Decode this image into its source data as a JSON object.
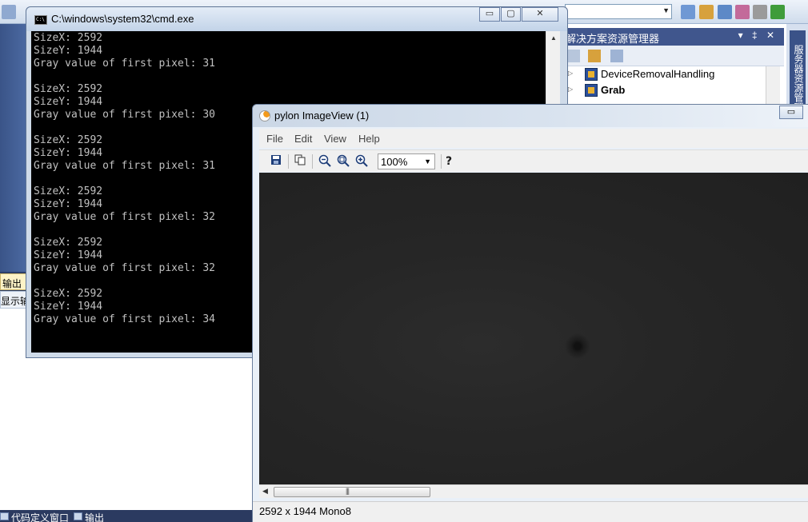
{
  "ide": {
    "combo_value": "",
    "solution_explorer": {
      "title": "解决方案资源管理器",
      "controls": "▾ ‡ ✕",
      "items": [
        {
          "label": "DeviceRemovalHandling",
          "expander": "▷"
        },
        {
          "label": "Grab",
          "expander": "▷"
        }
      ]
    },
    "right_rail_label": "服务器资源管理器",
    "left_tabs": [
      "输出",
      "显示输"
    ],
    "bottom_tabs": [
      "代码定义窗口",
      "输出"
    ]
  },
  "cmd": {
    "title": "C:\\windows\\system32\\cmd.exe",
    "buttons": {
      "minimize": "▭",
      "maximize": "▢",
      "close": "✕"
    },
    "lines": [
      "SizeX: 2592",
      "SizeY: 1944",
      "Gray value of first pixel: 31",
      "",
      "SizeX: 2592",
      "SizeY: 1944",
      "Gray value of first pixel: 30",
      "",
      "SizeX: 2592",
      "SizeY: 1944",
      "Gray value of first pixel: 31",
      "",
      "SizeX: 2592",
      "SizeY: 1944",
      "Gray value of first pixel: 32",
      "",
      "SizeX: 2592",
      "SizeY: 1944",
      "Gray value of first pixel: 32",
      "",
      "SizeX: 2592",
      "SizeY: 1944",
      "Gray value of first pixel: 34"
    ]
  },
  "pylon": {
    "title": "pylon ImageView (1)",
    "minimize": "▭",
    "menu": [
      "File",
      "Edit",
      "View",
      "Help"
    ],
    "toolbar": {
      "save_icon": "💾",
      "copy_icon": "⎘",
      "zoom_out_icon": "🔍-",
      "zoom_fit_icon": "🔍",
      "zoom_in_icon": "🔍+",
      "zoom_value": "100%",
      "help_icon": "?"
    },
    "status": "2592 x 1944 Mono8"
  }
}
